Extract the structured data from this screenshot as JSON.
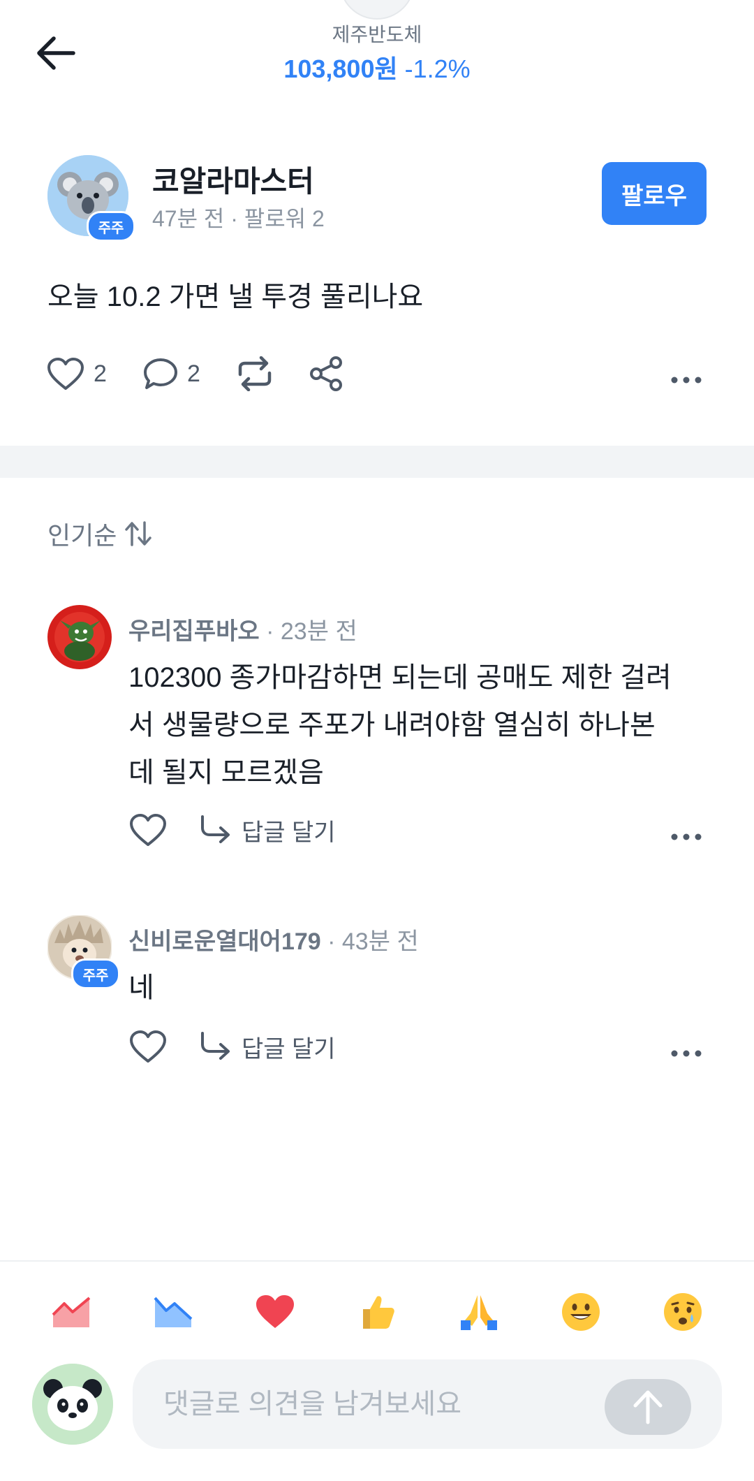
{
  "header": {
    "stock_name": "제주반도체",
    "price": "103,800원",
    "change": "-1.2%"
  },
  "post": {
    "author": "코알라마스터",
    "badge": "주주",
    "meta": "47분 전 · 팔로워 2",
    "follow_label": "팔로우",
    "body": "오늘 10.2 가면 낼 투경 풀리나요",
    "like_count": "2",
    "comment_count": "2"
  },
  "sort": {
    "label": "인기순"
  },
  "comments": [
    {
      "author": "우리집푸바오",
      "time": " · 23분 전",
      "body": "102300 종가마감하면 되는데 공매도 제한 걸려서 생물량으로 주포가 내려야함 열심히 하나본데 될지 모르겠음",
      "reply_label": "답글 달기"
    },
    {
      "author": "신비로운열대어179",
      "time": " · 43분 전",
      "badge": "주주",
      "body": "네",
      "reply_label": "답글 달기"
    }
  ],
  "reactions": [
    "chart-up-icon",
    "chart-down-icon",
    "heart-icon",
    "thumbs-up-icon",
    "folded-hands-icon",
    "smile-icon",
    "teary-face-icon"
  ],
  "composer": {
    "placeholder": "댓글로 의견을 남겨보세요"
  },
  "colors": {
    "accent": "#3182f6",
    "divider": "#f2f4f6"
  }
}
